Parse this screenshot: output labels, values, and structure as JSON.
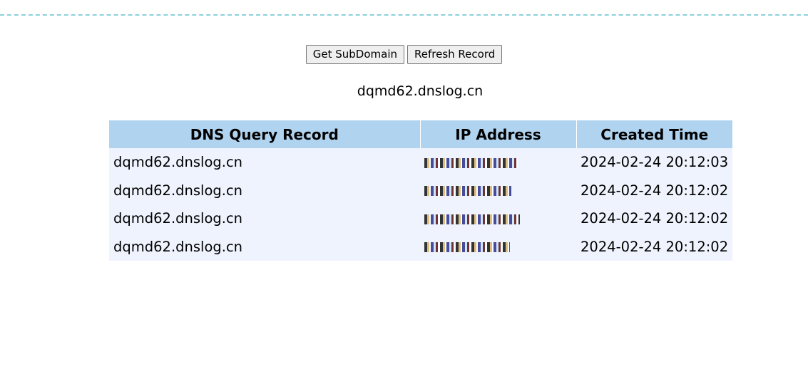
{
  "actions": {
    "get_subdomain_label": "Get SubDomain",
    "refresh_label": "Refresh Record"
  },
  "subdomain": "dqmd62.dnslog.cn",
  "table": {
    "columns": [
      "DNS Query Record",
      "IP Address",
      "Created Time"
    ],
    "rows": [
      {
        "record": "dqmd62.dnslog.cn",
        "ip": "[redacted]",
        "time": "2024-02-24 20:12:03"
      },
      {
        "record": "dqmd62.dnslog.cn",
        "ip": "[redacted]",
        "time": "2024-02-24 20:12:02"
      },
      {
        "record": "dqmd62.dnslog.cn",
        "ip": "[redacted]",
        "time": "2024-02-24 20:12:02"
      },
      {
        "record": "dqmd62.dnslog.cn",
        "ip": "[redacted]",
        "time": "2024-02-24 20:12:02"
      }
    ]
  },
  "colors": {
    "header_bg": "#b0d3ef",
    "row_bg": "#eef3fd",
    "divider": "#8fd0dc"
  }
}
